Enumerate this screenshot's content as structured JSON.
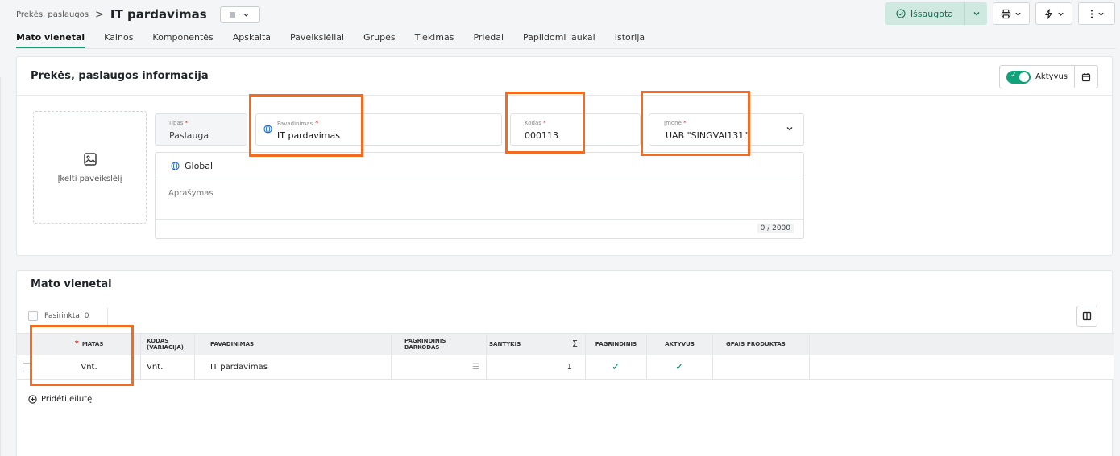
{
  "header": {
    "breadcrumb_parent": "Prekės, paslaugos",
    "breadcrumb_sep": ">",
    "title": "IT pardavimas",
    "status_value": "-"
  },
  "tabs": [
    {
      "label": "Mato vienetai",
      "active": true
    },
    {
      "label": "Kainos"
    },
    {
      "label": "Komponentės"
    },
    {
      "label": "Apskaita"
    },
    {
      "label": "Paveikslėliai"
    },
    {
      "label": "Grupės"
    },
    {
      "label": "Tiekimas"
    },
    {
      "label": "Priedai"
    },
    {
      "label": "Papildomi laukai"
    },
    {
      "label": "Istorija"
    }
  ],
  "actions": {
    "save_label": "Išsaugota",
    "print_icon": "printer-icon",
    "quick_icon": "lightning-icon",
    "more_icon": "more-vertical-icon"
  },
  "info_card": {
    "title": "Prekės, paslaugos informacija",
    "active_label": "Aktyvus",
    "upload_label": "Įkelti paveikslėlį",
    "tipas": {
      "label": "Tipas",
      "value": "Paslauga"
    },
    "pavadinimas": {
      "label": "Pavadinimas",
      "value": "IT pardavimas"
    },
    "kodas": {
      "label": "Kodas",
      "value": "000113"
    },
    "imone": {
      "label": "Įmonė",
      "value": "UAB \"SINGVAI131\""
    },
    "description": {
      "language": "Global",
      "placeholder": "Aprašymas",
      "counter": "0 / 2000"
    }
  },
  "units_card": {
    "title": "Mato vienetai",
    "selected_label": "Pasirinkta: 0",
    "add_row_label": "Pridėti eilutę",
    "columns": {
      "matas": "MATAS",
      "kodas_1": "KODAS",
      "kodas_2": "(VARIACIJA)",
      "pavadinimas": "PAVADINIMAS",
      "barkodas_1": "PAGRINDINIS",
      "barkodas_2": "BARKODAS",
      "santykis": "SANTYKIS",
      "sigma": "Σ",
      "pagrindinis": "PAGRINDINIS",
      "aktyvus": "AKTYVUS",
      "gpais": "GPAIS PRODUKTAS"
    },
    "rows": [
      {
        "matas": "Vnt.",
        "kodas": "Vnt.",
        "pavadinimas": "IT pardavimas",
        "barkodas": "",
        "santykis": "1",
        "pagrindinis": "✓",
        "aktyvus": "✓",
        "gpais": ""
      }
    ]
  },
  "colors": {
    "accent": "#0f9d74",
    "highlight": "#f26b21",
    "required": "#d32f2f"
  }
}
